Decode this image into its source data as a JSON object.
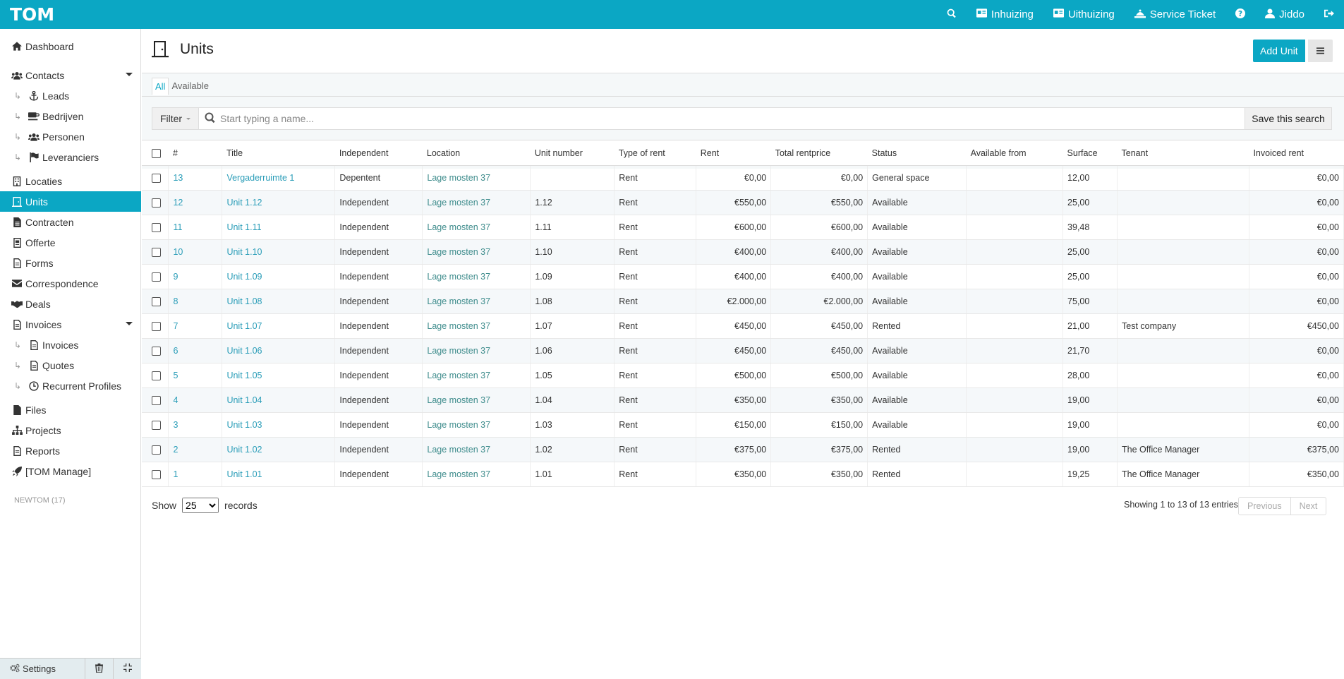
{
  "app": {
    "logo": "TOM"
  },
  "topbar": {
    "items": [
      {
        "label": "",
        "icon": "search-icon"
      },
      {
        "label": "Inhuizing",
        "icon": "id-card-icon"
      },
      {
        "label": "Uithuizing",
        "icon": "id-card-icon"
      },
      {
        "label": "Service Ticket",
        "icon": "service-icon"
      },
      {
        "label": "",
        "icon": "help-icon"
      },
      {
        "label": "Jiddo",
        "icon": "user-icon"
      },
      {
        "label": "",
        "icon": "logout-icon"
      }
    ]
  },
  "sidebar": {
    "items": [
      {
        "label": "Dashboard",
        "icon": "home-icon"
      },
      {
        "label": "Contacts",
        "icon": "users-icon",
        "has_caret": true
      },
      {
        "label": "Leads",
        "icon": "anchor-icon",
        "sub": true
      },
      {
        "label": "Bedrijven",
        "icon": "coffee-icon",
        "sub": true
      },
      {
        "label": "Personen",
        "icon": "users-icon",
        "sub": true
      },
      {
        "label": "Leveranciers",
        "icon": "flag-icon",
        "sub": true
      },
      {
        "label": "Locaties",
        "icon": "building-icon"
      },
      {
        "label": "Units",
        "icon": "door-icon",
        "active": true
      },
      {
        "label": "Contracten",
        "icon": "file-icon"
      },
      {
        "label": "Offerte",
        "icon": "file-icon"
      },
      {
        "label": "Forms",
        "icon": "file-icon"
      },
      {
        "label": "Correspondence",
        "icon": "envelope-icon"
      },
      {
        "label": "Deals",
        "icon": "handshake-icon"
      },
      {
        "label": "Invoices",
        "icon": "invoice-icon",
        "has_caret": true
      },
      {
        "label": "Invoices",
        "icon": "invoice-icon",
        "sub": true
      },
      {
        "label": "Quotes",
        "icon": "invoice-icon",
        "sub": true
      },
      {
        "label": "Recurrent Profiles",
        "icon": "clock-icon",
        "sub": true
      },
      {
        "label": "Files",
        "icon": "file-icon"
      },
      {
        "label": "Projects",
        "icon": "sitemap-icon"
      },
      {
        "label": "Reports",
        "icon": "file-icon"
      },
      {
        "label": "[TOM Manage]",
        "icon": "rocket-icon"
      }
    ],
    "footer_label": "NEWTOM (17)",
    "settings_label": "Settings"
  },
  "page": {
    "title": "Units",
    "add_button": "Add Unit",
    "tabs": [
      "All",
      "Available"
    ],
    "filter_label": "Filter",
    "search_placeholder": "Start typing a name...",
    "save_search": "Save this search"
  },
  "table": {
    "columns": [
      "#",
      "Title",
      "Independent",
      "Location",
      "Unit number",
      "Type of rent",
      "Rent",
      "Total rentprice",
      "Status",
      "Available from",
      "Surface",
      "Tenant",
      "Invoiced rent"
    ],
    "rows": [
      [
        "13",
        "Vergaderruimte 1",
        "Depentent",
        "Lage mosten 37",
        "",
        "Rent",
        "€0,00",
        "€0,00",
        "General space",
        "",
        "12,00",
        "",
        "€0,00"
      ],
      [
        "12",
        "Unit 1.12",
        "Independent",
        "Lage mosten 37",
        "1.12",
        "Rent",
        "€550,00",
        "€550,00",
        "Available",
        "",
        "25,00",
        "",
        "€0,00"
      ],
      [
        "11",
        "Unit 1.11",
        "Independent",
        "Lage mosten 37",
        "1.11",
        "Rent",
        "€600,00",
        "€600,00",
        "Available",
        "",
        "39,48",
        "",
        "€0,00"
      ],
      [
        "10",
        "Unit 1.10",
        "Independent",
        "Lage mosten 37",
        "1.10",
        "Rent",
        "€400,00",
        "€400,00",
        "Available",
        "",
        "25,00",
        "",
        "€0,00"
      ],
      [
        "9",
        "Unit 1.09",
        "Independent",
        "Lage mosten 37",
        "1.09",
        "Rent",
        "€400,00",
        "€400,00",
        "Available",
        "",
        "25,00",
        "",
        "€0,00"
      ],
      [
        "8",
        "Unit 1.08",
        "Independent",
        "Lage mosten 37",
        "1.08",
        "Rent",
        "€2.000,00",
        "€2.000,00",
        "Available",
        "",
        "75,00",
        "",
        "€0,00"
      ],
      [
        "7",
        "Unit 1.07",
        "Independent",
        "Lage mosten 37",
        "1.07",
        "Rent",
        "€450,00",
        "€450,00",
        "Rented",
        "",
        "21,00",
        "Test company",
        "€450,00"
      ],
      [
        "6",
        "Unit 1.06",
        "Independent",
        "Lage mosten 37",
        "1.06",
        "Rent",
        "€450,00",
        "€450,00",
        "Available",
        "",
        "21,70",
        "",
        "€0,00"
      ],
      [
        "5",
        "Unit 1.05",
        "Independent",
        "Lage mosten 37",
        "1.05",
        "Rent",
        "€500,00",
        "€500,00",
        "Available",
        "",
        "28,00",
        "",
        "€0,00"
      ],
      [
        "4",
        "Unit 1.04",
        "Independent",
        "Lage mosten 37",
        "1.04",
        "Rent",
        "€350,00",
        "€350,00",
        "Available",
        "",
        "19,00",
        "",
        "€0,00"
      ],
      [
        "3",
        "Unit 1.03",
        "Independent",
        "Lage mosten 37",
        "1.03",
        "Rent",
        "€150,00",
        "€150,00",
        "Available",
        "",
        "19,00",
        "",
        "€0,00"
      ],
      [
        "2",
        "Unit 1.02",
        "Independent",
        "Lage mosten 37",
        "1.02",
        "Rent",
        "€375,00",
        "€375,00",
        "Rented",
        "",
        "19,00",
        "The Office Manager",
        "€375,00"
      ],
      [
        "1",
        "Unit 1.01",
        "Independent",
        "Lage mosten 37",
        "1.01",
        "Rent",
        "€350,00",
        "€350,00",
        "Rented",
        "",
        "19,25",
        "The Office Manager",
        "€350,00"
      ]
    ]
  },
  "footer": {
    "show_label": "Show",
    "page_size": "25",
    "records_label": "records",
    "showing_text": "Showing 1 to 13 of 13 entries",
    "previous": "Previous",
    "next": "Next"
  }
}
